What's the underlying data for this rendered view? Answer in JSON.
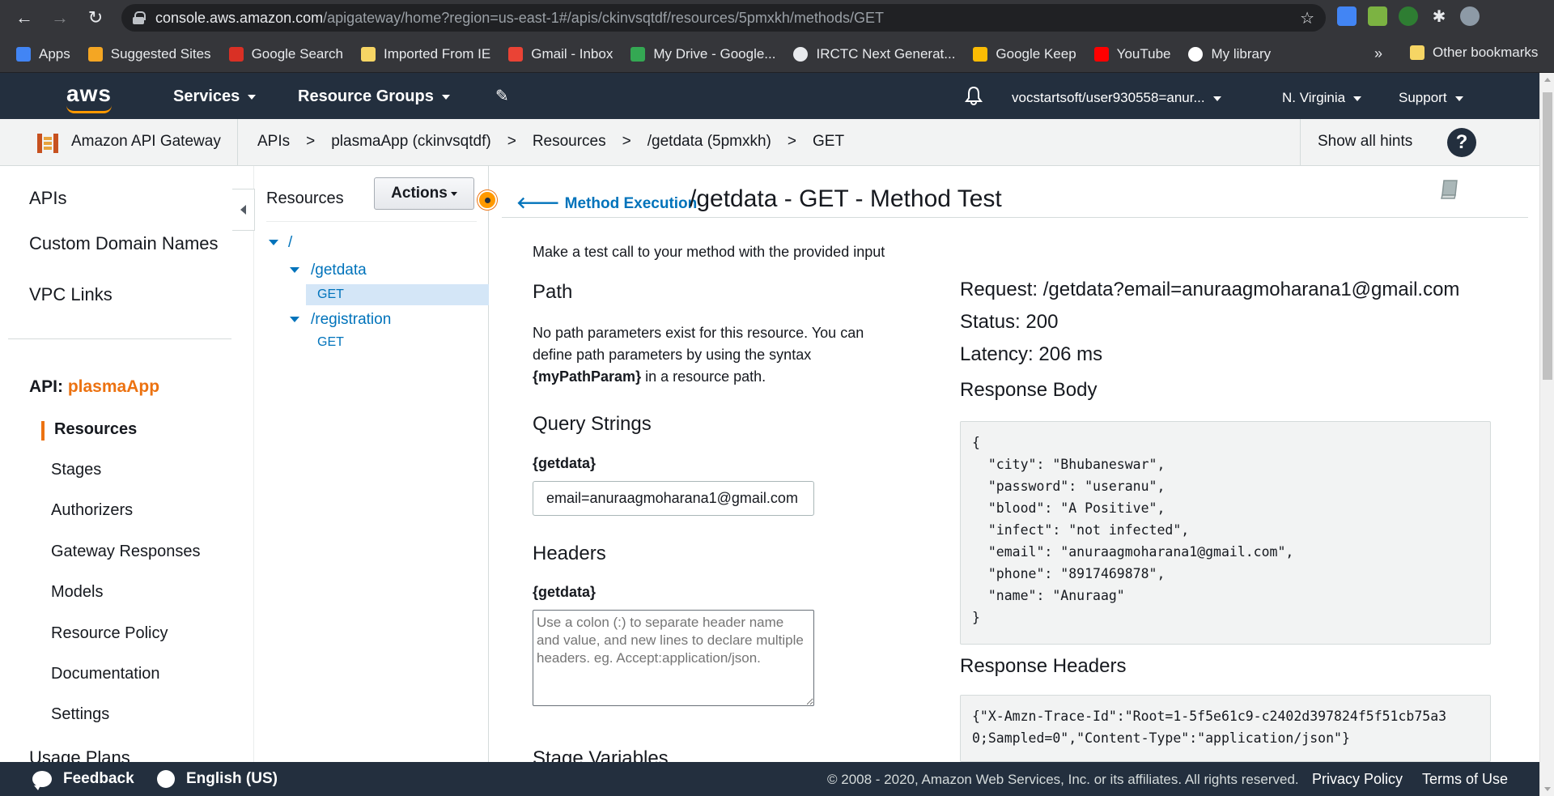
{
  "browser": {
    "url_host": "console.aws.amazon.com",
    "url_path": "/apigateway/home?region=us-east-1#/apis/ckinvsqtdf/resources/5pmxkh/methods/GET",
    "bookmarks": [
      {
        "label": "Apps",
        "color": "#4285f4"
      },
      {
        "label": "Suggested Sites",
        "color": "#f4a623"
      },
      {
        "label": "Google Search",
        "color": "#d93025"
      },
      {
        "label": "Imported From IE",
        "color": "#f6d564"
      },
      {
        "label": "Gmail - Inbox",
        "color": "#ea4335"
      },
      {
        "label": "My Drive - Google...",
        "color": "#34a853"
      },
      {
        "label": "IRCTC Next Generat...",
        "color": "#e8eaed"
      },
      {
        "label": "Google Keep",
        "color": "#fbbc04"
      },
      {
        "label": "YouTube",
        "color": "#ff0000"
      },
      {
        "label": "My library",
        "color": "#ffffff"
      }
    ],
    "more": "»",
    "other_bookmarks": "Other bookmarks"
  },
  "aws_header": {
    "logo": "aws",
    "services": "Services",
    "resource_groups": "Resource Groups",
    "account": "vocstartsoft/user930558=anur...",
    "region": "N. Virginia",
    "support": "Support"
  },
  "breadcrumb": {
    "service": "Amazon API Gateway",
    "items": [
      "APIs",
      "plasmaApp (ckinvsqtdf)",
      "Resources",
      "/getdata (5pmxkh)",
      "GET"
    ],
    "separator": ">",
    "show_hints": "Show all hints",
    "help": "?"
  },
  "leftnav": {
    "top_items": [
      "APIs",
      "Custom Domain Names",
      "VPC Links"
    ],
    "api_prefix": "API:",
    "api_name": "plasmaApp",
    "sub_items": [
      "Resources",
      "Stages",
      "Authorizers",
      "Gateway Responses",
      "Models",
      "Resource Policy",
      "Documentation",
      "Settings"
    ],
    "usage_plans": "Usage Plans"
  },
  "resources": {
    "title": "Resources",
    "actions": "Actions",
    "root": "/",
    "getdata": "/getdata",
    "getdata_method": "GET",
    "registration": "/registration",
    "registration_method": "GET"
  },
  "main": {
    "back": "Method Execution",
    "title": "/getdata - GET - Method Test",
    "intro": "Make a test call to your method with the provided input",
    "path_heading": "Path",
    "path_text_1": "No path parameters exist for this resource. You can define path parameters by using the syntax ",
    "path_text_bold": "{myPathParam}",
    "path_text_2": " in a resource path.",
    "qs_heading": "Query Strings",
    "qs_label": "{getdata}",
    "qs_value": "email=anuraagmoharana1@gmail.com",
    "headers_heading": "Headers",
    "headers_label": "{getdata}",
    "headers_placeholder": "Use a colon (:) to separate header name and value, and new lines to declare multiple headers. eg. Accept:application/json.",
    "stage_vars_heading": "Stage Variables"
  },
  "result": {
    "request": "Request: /getdata?email=anuraagmoharana1@gmail.com",
    "status": "Status: 200",
    "latency": "Latency: 206 ms",
    "body_heading": "Response Body",
    "body": "{\n  \"city\": \"Bhubaneswar\",\n  \"password\": \"useranu\",\n  \"blood\": \"A Positive\",\n  \"infect\": \"not infected\",\n  \"email\": \"anuraagmoharana1@gmail.com\",\n  \"phone\": \"8917469878\",\n  \"name\": \"Anuraag\"\n}",
    "headers_heading": "Response Headers",
    "headers": "{\"X-Amzn-Trace-Id\":\"Root=1-5f5e61c9-c2402d397824f5f51cb75a3\n0;Sampled=0\",\"Content-Type\":\"application/json\"}"
  },
  "footer": {
    "feedback": "Feedback",
    "language": "English (US)",
    "copyright": "© 2008 - 2020, Amazon Web Services, Inc. or its affiliates. All rights reserved.",
    "privacy": "Privacy Policy",
    "terms": "Terms of Use"
  },
  "colors": {
    "aws_dark": "#232f3e",
    "aws_orange": "#ec7211",
    "link_blue": "#0073bb"
  }
}
